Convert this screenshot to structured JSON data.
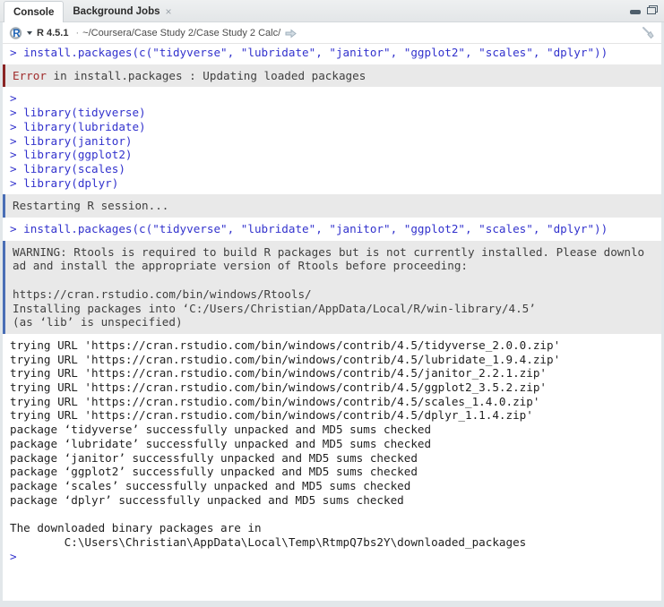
{
  "tabs": [
    {
      "label": "Console",
      "active": true
    },
    {
      "label": "Background Jobs",
      "active": false,
      "close_glyph": "×"
    }
  ],
  "window_controls": {
    "minimize": "minimize-icon",
    "restore": "restore-panes-icon"
  },
  "toolbar": {
    "r_logo_letter": "R",
    "version": "R 4.5.1",
    "separator": "·",
    "working_dir": "~/Coursera/Case Study 2/Case Study 2 Calc/",
    "goto_arrow_icon": "go-to-directory-arrow",
    "broom_icon": "clear-console-broom"
  },
  "colors": {
    "input_blue": "#3232cd",
    "output_text": "#1f1f1f",
    "block_bg": "#e9e9e9",
    "block_text": "#3f3f3f",
    "error_red": "#a02c2c",
    "error_border": "#8a2424",
    "info_border": "#4a6eb5",
    "logo_blue": "#1e63b5"
  },
  "console": {
    "segments": [
      {
        "type": "input",
        "lines": [
          "> install.packages(c(\"tidyverse\", \"lubridate\", \"janitor\", \"ggplot2\", \"scales\", \"dplyr\"))"
        ]
      },
      {
        "type": "error",
        "prefix": "Error",
        "rest": " in install.packages : Updating loaded packages"
      },
      {
        "type": "input",
        "lines": [
          "> "
        ]
      },
      {
        "type": "input",
        "lines": [
          "> library(tidyverse)",
          "> library(lubridate)",
          "> library(janitor)",
          "> library(ggplot2)",
          "> library(scales)",
          "> library(dplyr)"
        ]
      },
      {
        "type": "info",
        "lines": [
          "Restarting R session..."
        ]
      },
      {
        "type": "input",
        "lines": [
          "> install.packages(c(\"tidyverse\", \"lubridate\", \"janitor\", \"ggplot2\", \"scales\", \"dplyr\"))"
        ]
      },
      {
        "type": "info",
        "lines": [
          "WARNING: Rtools is required to build R packages but is not currently installed. Please downlo",
          "ad and install the appropriate version of Rtools before proceeding:",
          "",
          "https://cran.rstudio.com/bin/windows/Rtools/",
          "Installing packages into ‘C:/Users/Christian/AppData/Local/R/win-library/4.5’",
          "(as ‘lib’ is unspecified)"
        ]
      },
      {
        "type": "output",
        "lines": [
          "trying URL 'https://cran.rstudio.com/bin/windows/contrib/4.5/tidyverse_2.0.0.zip'",
          "trying URL 'https://cran.rstudio.com/bin/windows/contrib/4.5/lubridate_1.9.4.zip'",
          "trying URL 'https://cran.rstudio.com/bin/windows/contrib/4.5/janitor_2.2.1.zip'",
          "trying URL 'https://cran.rstudio.com/bin/windows/contrib/4.5/ggplot2_3.5.2.zip'",
          "trying URL 'https://cran.rstudio.com/bin/windows/contrib/4.5/scales_1.4.0.zip'",
          "trying URL 'https://cran.rstudio.com/bin/windows/contrib/4.5/dplyr_1.1.4.zip'",
          "package ‘tidyverse’ successfully unpacked and MD5 sums checked",
          "package ‘lubridate’ successfully unpacked and MD5 sums checked",
          "package ‘janitor’ successfully unpacked and MD5 sums checked",
          "package ‘ggplot2’ successfully unpacked and MD5 sums checked",
          "package ‘scales’ successfully unpacked and MD5 sums checked",
          "package ‘dplyr’ successfully unpacked and MD5 sums checked",
          "",
          "The downloaded binary packages are in",
          "        C:\\Users\\Christian\\AppData\\Local\\Temp\\RtmpQ7bs2Y\\downloaded_packages"
        ]
      },
      {
        "type": "input",
        "lines": [
          "> "
        ]
      }
    ]
  }
}
